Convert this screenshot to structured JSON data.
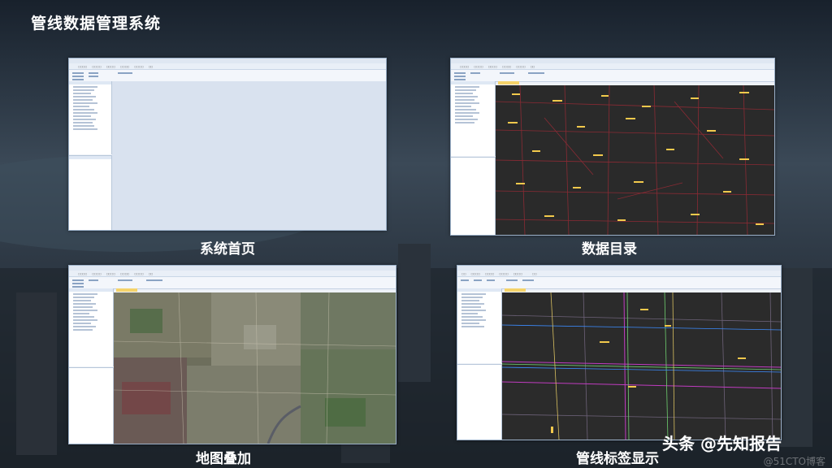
{
  "page_title": "管线数据管理系统",
  "panels": [
    {
      "caption": "系统首页"
    },
    {
      "caption": "数据目录"
    },
    {
      "caption": "地图叠加"
    },
    {
      "caption": "管线标签显示"
    }
  ],
  "footer": {
    "brand": "头条 @先知报告",
    "watermark": "@51CTO博客"
  },
  "colors": {
    "title_text": "#ffffff",
    "window_frame": "#9bb0c8",
    "map_dark": "#2b2b2b",
    "road_red": "#8a2a34",
    "road_label": "#f2c94c",
    "pipe_magenta": "#c03cc0",
    "pipe_green": "#6fd06f",
    "pipe_blue": "#3c8cff"
  }
}
